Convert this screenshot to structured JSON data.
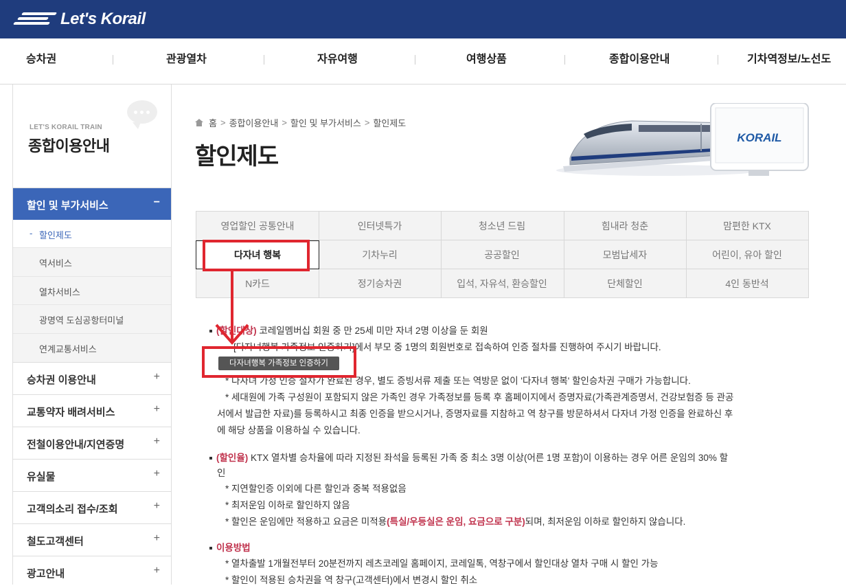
{
  "header": {
    "logo_text": "Let's Korail"
  },
  "nav": [
    "승차권",
    "관광열차",
    "자유여행",
    "여행상품",
    "종합이용안내",
    "기차역정보/노선도"
  ],
  "sidebar": {
    "subtitle": "LET'S KORAIL TRAIN",
    "title": "종합이용안내",
    "active": {
      "label": "할인 및 부가서비스",
      "symbol": "−"
    },
    "subitems": [
      {
        "label": "할인제도",
        "current": true,
        "dash": "-"
      },
      {
        "label": "역서비스"
      },
      {
        "label": "열차서비스"
      },
      {
        "label": "광명역 도심공항터미널"
      },
      {
        "label": "연계교통서비스"
      }
    ],
    "items": [
      {
        "label": "승차권 이용안내",
        "symbol": "+"
      },
      {
        "label": "교통약자 배려서비스",
        "symbol": "+"
      },
      {
        "label": "전철이용안내/지연증명",
        "symbol": "+"
      },
      {
        "label": "유실물",
        "symbol": "+"
      },
      {
        "label": "고객의소리 접수/조회",
        "symbol": "+"
      },
      {
        "label": "철도고객센터",
        "symbol": "+"
      },
      {
        "label": "광고안내",
        "symbol": "+"
      }
    ]
  },
  "breadcrumb": [
    "홈",
    "종합이용안내",
    "할인 및 부가서비스",
    "할인제도"
  ],
  "breadcrumb_sep": ">",
  "page_title": "할인제도",
  "banner": {
    "brand": "KORAIL"
  },
  "tabs": [
    [
      "영업할인 공통안내",
      "인터넷특가",
      "청소년 드림",
      "힘내라 청춘",
      "맘편한 KTX"
    ],
    [
      "다자녀 행복",
      "기차누리",
      "공공할인",
      "모범납세자",
      "어린이, 유아 할인"
    ],
    [
      "N카드",
      "정기승차권",
      "입석, 자유석, 환승할인",
      "단체할인",
      "4인 동반석"
    ]
  ],
  "content": {
    "target_label": "(할인대상)",
    "target_text": " 코레일멤버십 회원 중 만 25세 미만 자녀 2명 이상을 둔 회원",
    "auth_text": "[다자녀행복 가족정보 인증하기]에서 부모 중 1명의 회원번호로 접속하여 인증 절차를 진행하여 주시기 바랍니다.",
    "cert_button": "다자녀행복 가족정보 인증하기",
    "note1": "* 다자녀 가정 인증 절차가 완료된 경우, 별도 증빙서류 제출 또는 역방문 없이 '다자녀 행복' 할인승차권 구매가 가능합니다.",
    "note2a": "* 세대원에 가족 구성원이 포함되지 않은 가족인 경우 가족정보를 등록 후 홈페이지에서 증명자료(가족관계증명서, 건강보험증 등 관공",
    "note2b": "서에서 발급한 자료)를 등록하시고 최종 인증을 받으시거나, 증명자료를 지참하고 역 창구를 방문하셔서 다자녀 가정 인증을 완료하신 후",
    "note2c": "에 해당 상품을 이용하실 수 있습니다.",
    "rate_label": "(할인율)",
    "rate_text": " KTX 열차별 승차율에 따라 지정된 좌석을 등록된 가족 중 최소 3명 이상(어른 1명 포함)이 이용하는 경우 어른 운임의 30% 할",
    "rate_text2": "인",
    "rate_n1": "* 지연할인증 이외에 다른 할인과 중복 적용없음",
    "rate_n2": "* 최저운임 이하로 할인하지 않음",
    "rate_n3a": "* 할인은 운임에만 적용하고 요금은 미적용",
    "rate_n3b": "(특실/우등실은 운임, 요금으로 구분)",
    "rate_n3c": "되며, 최저운임 이하로 할인하지 않습니다.",
    "use_label": "이용방법",
    "use_n1": "* 열차출발 1개월전부터 20분전까지 레츠코레일 홈페이지, 코레일톡, 역창구에서 할인대상 열차 구매 시 할인 가능",
    "use_n2": "* 할인이 적용된 승차권을 역 창구(고객센터)에서 변경시 할인 취소"
  },
  "colors": {
    "topbar": "#1f3c7d",
    "sidebar_active": "#3b66b8",
    "highlight": "#c0334d",
    "annotation": "#e0262f"
  }
}
